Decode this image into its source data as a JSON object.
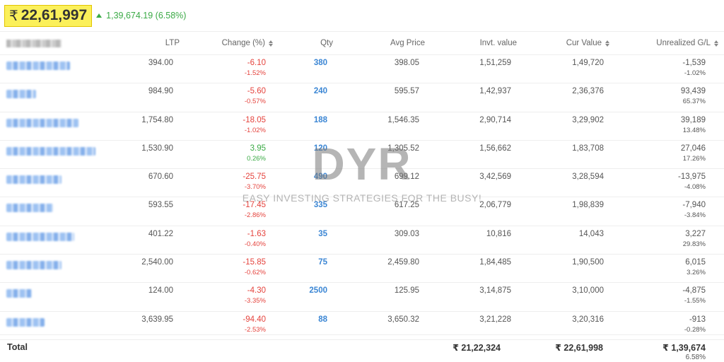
{
  "summary": {
    "currency": "₹",
    "current_value": "22,61,997",
    "day_change": "1,39,674.19 (6.58%)"
  },
  "columns": {
    "instrument_blurred": true,
    "ltp": "LTP",
    "change": "Change (%)",
    "qty": "Qty",
    "avg_price": "Avg Price",
    "invt_value": "Invt. value",
    "cur_value": "Cur Value",
    "unrealized": "Unrealized G/L"
  },
  "rows": [
    {
      "ltp": "394.00",
      "change": "-6.10",
      "change_pct": "-1.52%",
      "dir": "neg",
      "qty": "380",
      "avg": "398.05",
      "invt": "1,51,259",
      "cur": "1,49,720",
      "gl": "-1,539",
      "gl_pct": "-1.02%",
      "name_w": 90
    },
    {
      "ltp": "984.90",
      "change": "-5.60",
      "change_pct": "-0.57%",
      "dir": "neg",
      "qty": "240",
      "avg": "595.57",
      "invt": "1,42,937",
      "cur": "2,36,376",
      "gl": "93,439",
      "gl_pct": "65.37%",
      "name_w": 42
    },
    {
      "ltp": "1,754.80",
      "change": "-18.05",
      "change_pct": "-1.02%",
      "dir": "neg",
      "qty": "188",
      "avg": "1,546.35",
      "invt": "2,90,714",
      "cur": "3,29,902",
      "gl": "39,189",
      "gl_pct": "13.48%",
      "name_w": 102
    },
    {
      "ltp": "1,530.90",
      "change": "3.95",
      "change_pct": "0.26%",
      "dir": "pos",
      "qty": "120",
      "avg": "1,305.52",
      "invt": "1,56,662",
      "cur": "1,83,708",
      "gl": "27,046",
      "gl_pct": "17.26%",
      "name_w": 126
    },
    {
      "ltp": "670.60",
      "change": "-25.75",
      "change_pct": "-3.70%",
      "dir": "neg",
      "qty": "490",
      "avg": "699.12",
      "invt": "3,42,569",
      "cur": "3,28,594",
      "gl": "-13,975",
      "gl_pct": "-4.08%",
      "name_w": 78
    },
    {
      "ltp": "593.55",
      "change": "-17.45",
      "change_pct": "-2.86%",
      "dir": "neg",
      "qty": "335",
      "avg": "617.25",
      "invt": "2,06,779",
      "cur": "1,98,839",
      "gl": "-7,940",
      "gl_pct": "-3.84%",
      "name_w": 66
    },
    {
      "ltp": "401.22",
      "change": "-1.63",
      "change_pct": "-0.40%",
      "dir": "neg",
      "qty": "35",
      "avg": "309.03",
      "invt": "10,816",
      "cur": "14,043",
      "gl": "3,227",
      "gl_pct": "29.83%",
      "name_w": 96
    },
    {
      "ltp": "2,540.00",
      "change": "-15.85",
      "change_pct": "-0.62%",
      "dir": "neg",
      "qty": "75",
      "avg": "2,459.80",
      "invt": "1,84,485",
      "cur": "1,90,500",
      "gl": "6,015",
      "gl_pct": "3.26%",
      "name_w": 78
    },
    {
      "ltp": "124.00",
      "change": "-4.30",
      "change_pct": "-3.35%",
      "dir": "neg",
      "qty": "2500",
      "avg": "125.95",
      "invt": "3,14,875",
      "cur": "3,10,000",
      "gl": "-4,875",
      "gl_pct": "-1.55%",
      "name_w": 36
    },
    {
      "ltp": "3,639.95",
      "change": "-94.40",
      "change_pct": "-2.53%",
      "dir": "neg",
      "qty": "88",
      "avg": "3,650.32",
      "invt": "3,21,228",
      "cur": "3,20,316",
      "gl": "-913",
      "gl_pct": "-0.28%",
      "name_w": 54
    }
  ],
  "total": {
    "label": "Total",
    "invt": "₹ 21,22,324",
    "cur": "₹ 22,61,998",
    "gl": "₹ 1,39,674",
    "gl_pct": "6.58%"
  },
  "watermark": {
    "big": "DYR",
    "small": "EASY INVESTING STRATEGIES FOR THE BUSY!"
  },
  "colors": {
    "positive": "#3aaa45",
    "negative": "#e5433d",
    "qty": "#3b86d4",
    "highlight": "#fbf05a"
  }
}
